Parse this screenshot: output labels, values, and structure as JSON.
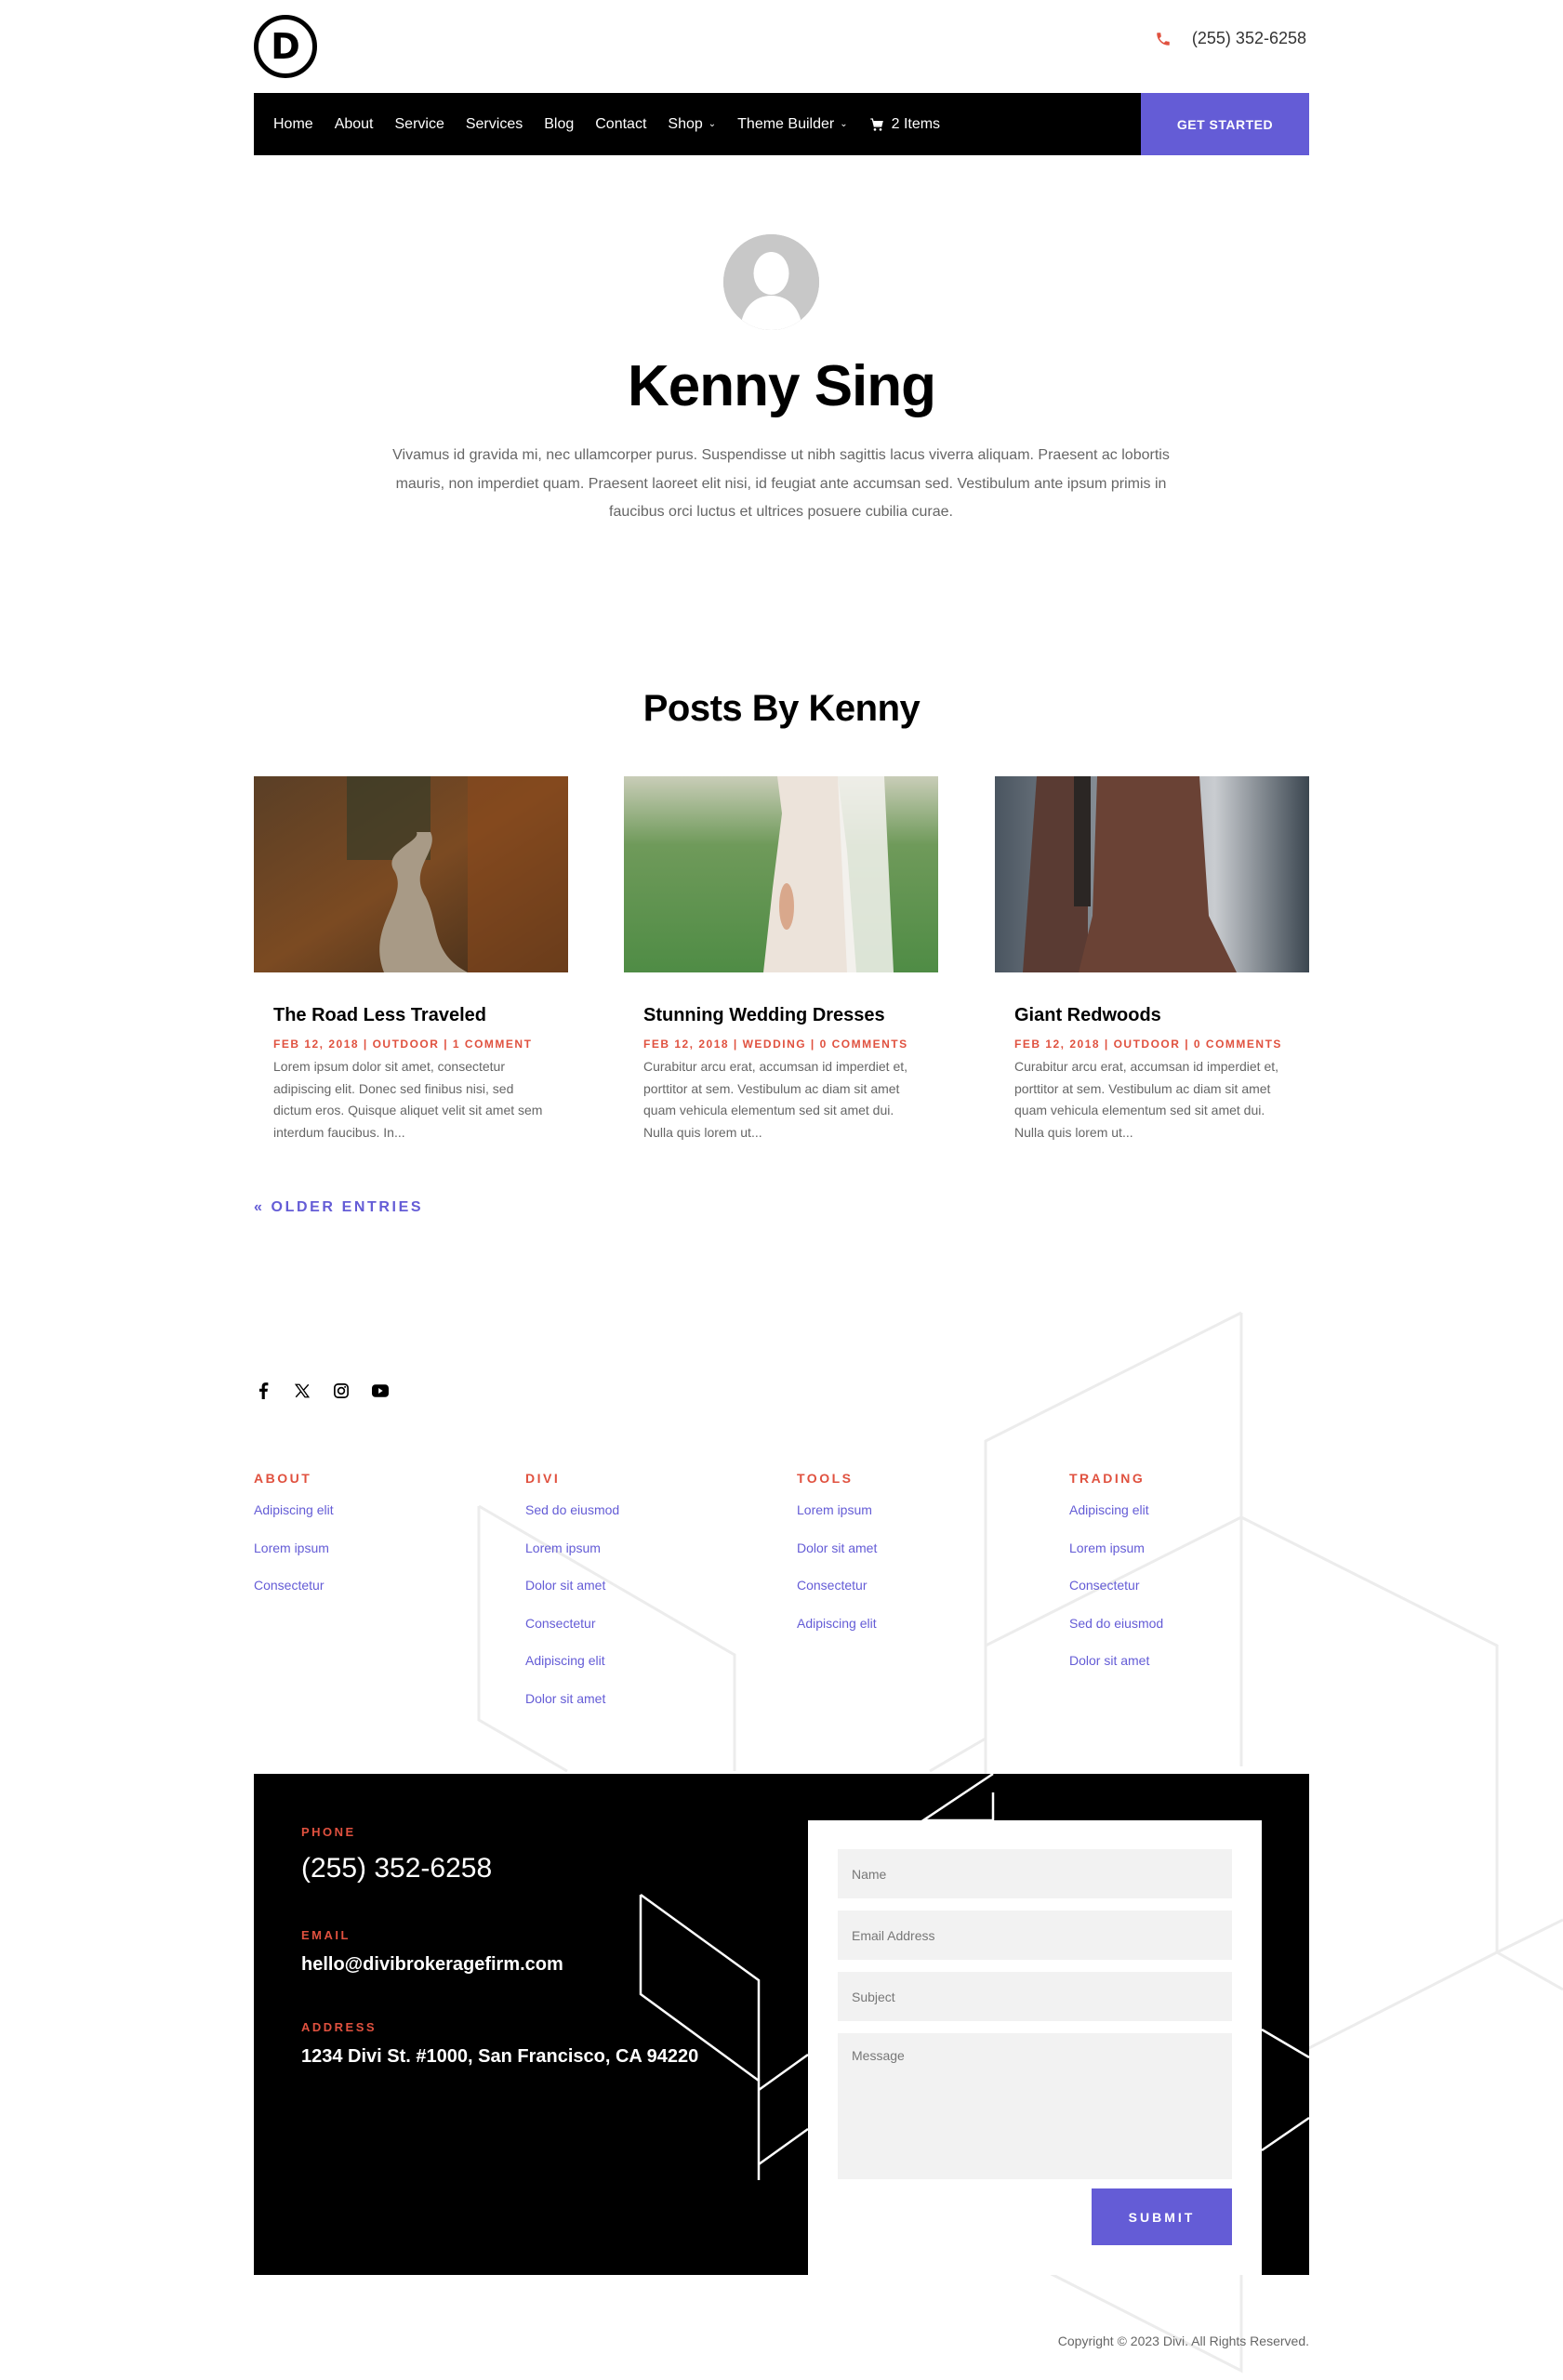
{
  "header": {
    "logo_letter": "D",
    "phone": "(255) 352-6258",
    "nav": [
      {
        "label": "Home"
      },
      {
        "label": "About"
      },
      {
        "label": "Service"
      },
      {
        "label": "Services"
      },
      {
        "label": "Blog"
      },
      {
        "label": "Contact"
      },
      {
        "label": "Shop",
        "dropdown": true
      },
      {
        "label": "Theme Builder",
        "dropdown": true
      }
    ],
    "cart_label": "2 Items",
    "cta_label": "GET STARTED"
  },
  "profile": {
    "name": "Kenny Sing",
    "bio": "Vivamus id gravida mi, nec ullamcorper purus. Suspendisse ut nibh sagittis lacus viverra aliquam. Praesent ac lobortis mauris, non imperdiet quam. Praesent laoreet elit nisi, id feugiat ante accumsan sed. Vestibulum ante ipsum primis in faucibus orci luctus et ultrices posuere cubilia curae."
  },
  "posts": {
    "title": "Posts By Kenny",
    "items": [
      {
        "title": "The Road Less Traveled",
        "meta": "FEB 12, 2018 | OUTDOOR | 1 COMMENT",
        "excerpt": "Lorem ipsum dolor sit amet, consectetur adipiscing elit. Donec sed finibus nisi, sed dictum eros. Quisque aliquet velit sit amet sem interdum faucibus. In...",
        "image": "forest-road-autumn"
      },
      {
        "title": "Stunning Wedding Dresses",
        "meta": "FEB 12, 2018 | WEDDING | 0 COMMENTS",
        "excerpt": "Curabitur arcu erat, accumsan id imperdiet et, porttitor at sem. Vestibulum ac diam sit amet quam vehicula elementum sed sit amet dui. Nulla quis lorem ut...",
        "image": "bride-in-lace-dress"
      },
      {
        "title": "Giant Redwoods",
        "meta": "FEB 12, 2018 | OUTDOOR | 0 COMMENTS",
        "excerpt": "Curabitur arcu erat, accumsan id imperdiet et, porttitor at sem. Vestibulum ac diam sit amet quam vehicula elementum sed sit amet dui. Nulla quis lorem ut...",
        "image": "redwood-trunks-fog"
      }
    ],
    "older_entries": "« OLDER ENTRIES"
  },
  "social": [
    "facebook-icon",
    "x-twitter-icon",
    "instagram-icon",
    "youtube-icon"
  ],
  "footer_columns": [
    {
      "heading": "ABOUT",
      "links": [
        "Adipiscing elit",
        "Lorem ipsum",
        "Consectetur"
      ]
    },
    {
      "heading": "DIVI",
      "links": [
        "Sed do eiusmod",
        "Lorem ipsum",
        "Dolor sit amet",
        "Consectetur",
        "Adipiscing elit",
        "Dolor sit amet"
      ]
    },
    {
      "heading": "TOOLS",
      "links": [
        "Lorem ipsum",
        "Dolor sit amet",
        "Consectetur",
        "Adipiscing elit"
      ]
    },
    {
      "heading": "TRADING",
      "links": [
        "Adipiscing elit",
        "Lorem ipsum",
        "Consectetur",
        "Sed do eiusmod",
        "Dolor sit amet"
      ]
    }
  ],
  "contact": {
    "phone_label": "PHONE",
    "phone": "(255) 352-6258",
    "email_label": "EMAIL",
    "email": "hello@divibrokeragefirm.com",
    "address_label": "ADDRESS",
    "address": "1234 Divi St. #1000, San Francisco, CA 94220"
  },
  "form": {
    "name_placeholder": "Name",
    "email_placeholder": "Email Address",
    "subject_placeholder": "Subject",
    "message_placeholder": "Message",
    "submit_label": "SUBMIT"
  },
  "copyright": "Copyright © 2023 Divi. All Rights Reserved.",
  "colors": {
    "accent": "#645cd6",
    "highlight": "#e0513f",
    "dark": "#000000"
  }
}
